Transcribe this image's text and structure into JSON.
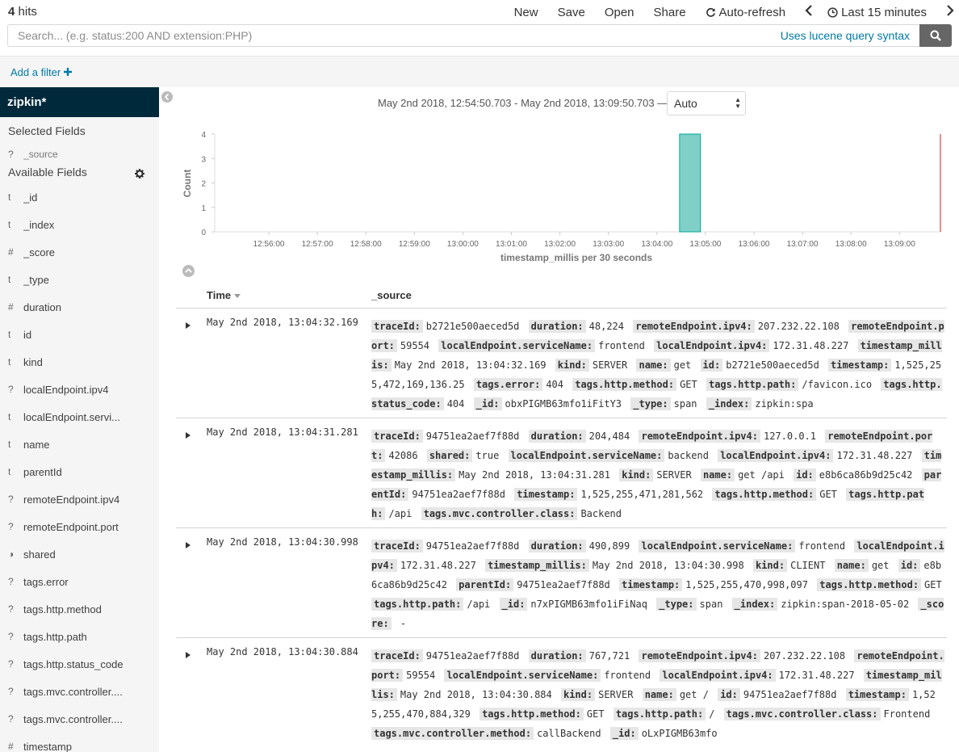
{
  "topbar": {
    "hits_count": "4",
    "hits_label": "hits",
    "menu": {
      "new": "New",
      "save": "Save",
      "open": "Open",
      "share": "Share",
      "auto_refresh": "Auto-refresh",
      "time_picker": "Last 15 minutes"
    }
  },
  "search": {
    "placeholder": "Search... (e.g. status:200 AND extension:PHP)",
    "value": "",
    "syntax_link": "Uses lucene query syntax"
  },
  "filter": {
    "add_label": "Add a filter"
  },
  "sidebar": {
    "index_pattern": "zipkin*",
    "selected_title": "Selected Fields",
    "selected_fields": [
      {
        "type": "?",
        "name": "_source"
      }
    ],
    "available_title": "Available Fields",
    "fields": [
      {
        "type": "t",
        "name": "_id"
      },
      {
        "type": "t",
        "name": "_index"
      },
      {
        "type": "#",
        "name": "_score"
      },
      {
        "type": "t",
        "name": "_type"
      },
      {
        "type": "#",
        "name": "duration"
      },
      {
        "type": "t",
        "name": "id"
      },
      {
        "type": "t",
        "name": "kind"
      },
      {
        "type": "?",
        "name": "localEndpoint.ipv4"
      },
      {
        "type": "t",
        "name": "localEndpoint.servi..."
      },
      {
        "type": "t",
        "name": "name"
      },
      {
        "type": "t",
        "name": "parentId"
      },
      {
        "type": "?",
        "name": "remoteEndpoint.ipv4"
      },
      {
        "type": "?",
        "name": "remoteEndpoint.port"
      },
      {
        "type": "◑",
        "name": "shared"
      },
      {
        "type": "?",
        "name": "tags.error"
      },
      {
        "type": "?",
        "name": "tags.http.method"
      },
      {
        "type": "?",
        "name": "tags.http.path"
      },
      {
        "type": "?",
        "name": "tags.http.status_code"
      },
      {
        "type": "?",
        "name": "tags.mvc.controller...."
      },
      {
        "type": "?",
        "name": "tags.mvc.controller...."
      },
      {
        "type": "#",
        "name": "timestamp"
      }
    ]
  },
  "histogram": {
    "time_range": "May 2nd 2018, 12:54:50.703 - May 2nd 2018, 13:09:50.703 —",
    "interval": "Auto"
  },
  "chart_data": {
    "type": "bar",
    "x": [
      "13:04:30"
    ],
    "values": [
      4
    ],
    "xticks": [
      "12:56:00",
      "12:57:00",
      "12:58:00",
      "12:59:00",
      "13:00:00",
      "13:01:00",
      "13:02:00",
      "13:03:00",
      "13:04:00",
      "13:05:00",
      "13:06:00",
      "13:07:00",
      "13:08:00",
      "13:09:00"
    ],
    "yticks": [
      "0",
      "1",
      "2",
      "3",
      "4"
    ],
    "ylim": [
      0,
      4
    ],
    "xlabel": "timestamp_millis per 30 seconds",
    "ylabel": "Count",
    "bar_color": "#7fd1c8",
    "bar_stroke": "#00a69b",
    "now_marker_color": "#e8646b"
  },
  "table": {
    "col_time": "Time",
    "col_source": "_source",
    "rows": [
      {
        "time": "May 2nd 2018, 13:04:32.169",
        "fields": [
          [
            "traceId:",
            "b2721e500aeced5d"
          ],
          [
            "duration:",
            "48,224"
          ],
          [
            "remoteEndpoint.ipv4:",
            "207.232.22.108"
          ],
          [
            "remoteEndpoint.port:",
            "59554"
          ],
          [
            "localEndpoint.serviceName:",
            "frontend"
          ],
          [
            "localEndpoint.ipv4:",
            "172.31.48.227"
          ],
          [
            "timestamp_millis:",
            "May 2nd 2018, 13:04:32.169"
          ],
          [
            "kind:",
            "SERVER"
          ],
          [
            "name:",
            "get"
          ],
          [
            "id:",
            "b2721e500aeced5d"
          ],
          [
            "timestamp:",
            "1,525,255,472,169,136.25"
          ],
          [
            "tags.error:",
            "404"
          ],
          [
            "tags.http.method:",
            "GET"
          ],
          [
            "tags.http.path:",
            "/favicon.ico"
          ],
          [
            "tags.http.status_code:",
            "404"
          ],
          [
            "_id:",
            "obxPIGMB63mfo1iFitY3"
          ],
          [
            "_type:",
            "span"
          ],
          [
            "_index:",
            "zipkin:spa"
          ]
        ]
      },
      {
        "time": "May 2nd 2018, 13:04:31.281",
        "fields": [
          [
            "traceId:",
            "94751ea2aef7f88d"
          ],
          [
            "duration:",
            "204,484"
          ],
          [
            "remoteEndpoint.ipv4:",
            "127.0.0.1"
          ],
          [
            "remoteEndpoint.port:",
            "42086"
          ],
          [
            "shared:",
            "true"
          ],
          [
            "localEndpoint.serviceName:",
            "backend"
          ],
          [
            "localEndpoint.ipv4:",
            "172.31.48.227"
          ],
          [
            "timestamp_millis:",
            "May 2nd 2018, 13:04:31.281"
          ],
          [
            "kind:",
            "SERVER"
          ],
          [
            "name:",
            "get /api"
          ],
          [
            "id:",
            "e8b6ca86b9d25c42"
          ],
          [
            "parentId:",
            "94751ea2aef7f88d"
          ],
          [
            "timestamp:",
            "1,525,255,471,281,562"
          ],
          [
            "tags.http.method:",
            "GET"
          ],
          [
            "tags.http.path:",
            "/api"
          ],
          [
            "tags.mvc.controller.class:",
            "Backend"
          ]
        ]
      },
      {
        "time": "May 2nd 2018, 13:04:30.998",
        "fields": [
          [
            "traceId:",
            "94751ea2aef7f88d"
          ],
          [
            "duration:",
            "490,899"
          ],
          [
            "localEndpoint.serviceName:",
            "frontend"
          ],
          [
            "localEndpoint.ipv4:",
            "172.31.48.227"
          ],
          [
            "timestamp_millis:",
            "May 2nd 2018, 13:04:30.998"
          ],
          [
            "kind:",
            "CLIENT"
          ],
          [
            "name:",
            "get"
          ],
          [
            "id:",
            "e8b6ca86b9d25c42"
          ],
          [
            "parentId:",
            "94751ea2aef7f88d"
          ],
          [
            "timestamp:",
            "1,525,255,470,998,097"
          ],
          [
            "tags.http.method:",
            "GET"
          ],
          [
            "tags.http.path:",
            "/api"
          ],
          [
            "_id:",
            "n7xPIGMB63mfo1iFiNaq"
          ],
          [
            "_type:",
            "span"
          ],
          [
            "_index:",
            "zipkin:span-2018-05-02"
          ],
          [
            "_score:",
            " -"
          ]
        ]
      },
      {
        "time": "May 2nd 2018, 13:04:30.884",
        "fields": [
          [
            "traceId:",
            "94751ea2aef7f88d"
          ],
          [
            "duration:",
            "767,721"
          ],
          [
            "remoteEndpoint.ipv4:",
            "207.232.22.108"
          ],
          [
            "remoteEndpoint.port:",
            "59554"
          ],
          [
            "localEndpoint.serviceName:",
            "frontend"
          ],
          [
            "localEndpoint.ipv4:",
            "172.31.48.227"
          ],
          [
            "timestamp_millis:",
            "May 2nd 2018, 13:04:30.884"
          ],
          [
            "kind:",
            "SERVER"
          ],
          [
            "name:",
            "get /"
          ],
          [
            "id:",
            "94751ea2aef7f88d"
          ],
          [
            "timestamp:",
            "1,525,255,470,884,329"
          ],
          [
            "tags.http.method:",
            "GET"
          ],
          [
            "tags.http.path:",
            "/"
          ],
          [
            "tags.mvc.controller.class:",
            "Frontend"
          ],
          [
            "tags.mvc.controller.method:",
            "callBackend"
          ],
          [
            "_id:",
            "oLxPIGMB63mfo"
          ]
        ]
      }
    ]
  }
}
